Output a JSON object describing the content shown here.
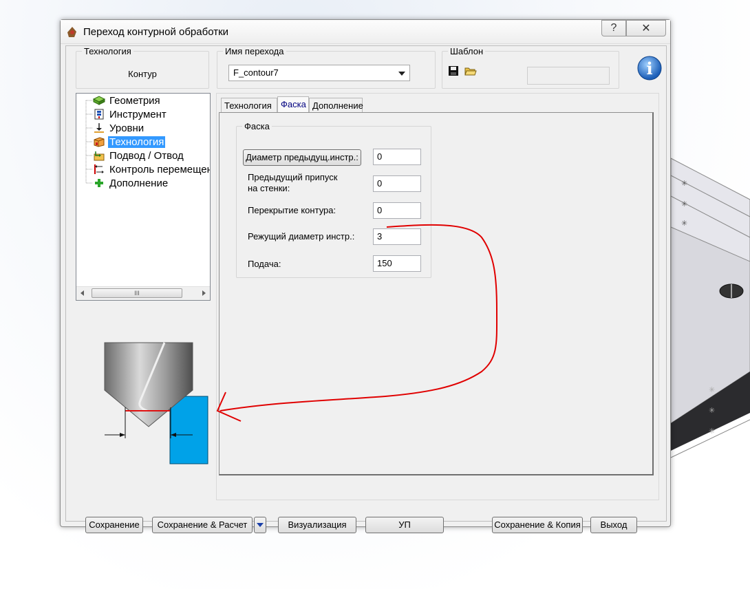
{
  "window": {
    "title": "Переход контурной обработки"
  },
  "titlebar": {
    "help_glyph": "?",
    "close_glyph": "✕"
  },
  "groups": {
    "technology": {
      "legend": "Технология",
      "value": "Контур"
    },
    "step_name": {
      "legend": "Имя перехода",
      "value": "F_contour7"
    },
    "template": {
      "legend": "Шаблон"
    }
  },
  "tree": {
    "items": [
      {
        "label": "Геометрия",
        "icon": "geometry-icon"
      },
      {
        "label": "Инструмент",
        "icon": "tool-icon"
      },
      {
        "label": "Уровни",
        "icon": "levels-icon"
      },
      {
        "label": "Технология",
        "icon": "technology-icon",
        "selected": true
      },
      {
        "label": "Подвод / Отвод",
        "icon": "approach-icon"
      },
      {
        "label": "Контроль перемещений",
        "icon": "motion-control-icon"
      },
      {
        "label": "Дополнение",
        "icon": "add-icon"
      }
    ],
    "scroll_thumb_glyph": "III"
  },
  "tabs": [
    {
      "label": "Технология",
      "active": false
    },
    {
      "label": "Фаска",
      "active": true
    },
    {
      "label": "Дополнение",
      "active": false
    }
  ],
  "facet": {
    "legend": "Фаска",
    "prev_tool_diam_button": "Диаметр предыдущ.инстр.:",
    "prev_tool_diam_value": "0",
    "prev_allowance_label_1": "Предыдущий припуск",
    "prev_allowance_label_2": "на стенки:",
    "prev_allowance_value": "0",
    "overlap_label": "Перекрытие контура:",
    "overlap_value": "0",
    "cut_diam_label": "Режущий диаметр инстр.:",
    "cut_diam_value": "3",
    "feed_label": "Подача:",
    "feed_value": "150"
  },
  "footer": {
    "save": "Сохранение",
    "save_calc": "Сохранение & Расчет",
    "visualize": "Визуализация",
    "nc": "УП",
    "save_copy": "Сохранение & Копия",
    "exit": "Выход"
  },
  "colors": {
    "selection": "#3399ff",
    "annotation_red": "#e00000",
    "workpiece_cyan": "#00a2e8",
    "active_tab_text": "#000080"
  }
}
